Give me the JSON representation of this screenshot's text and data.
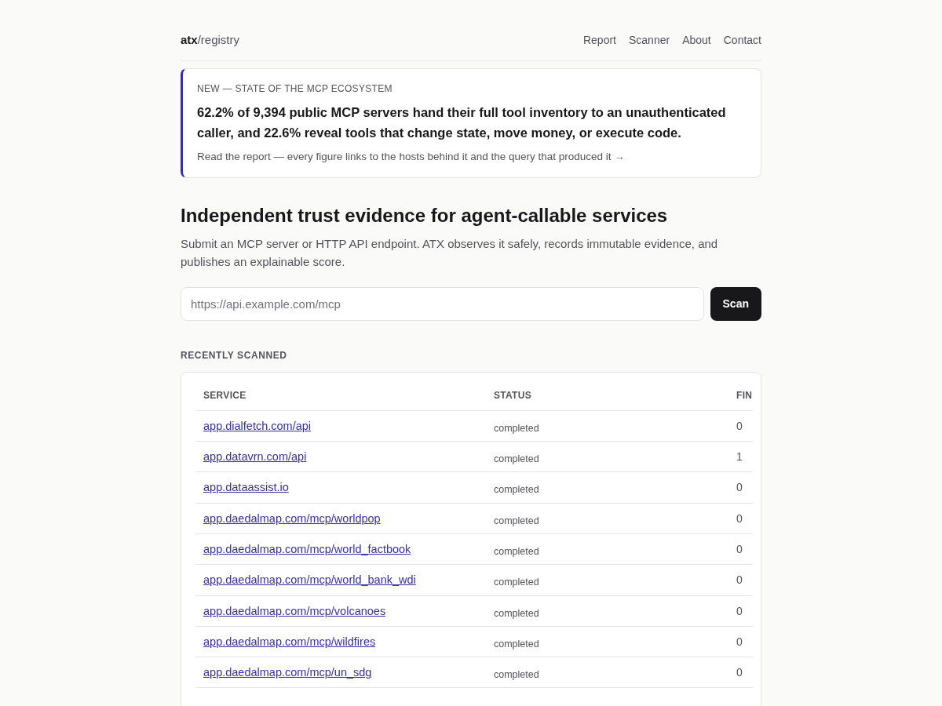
{
  "brand": {
    "name": "atx",
    "suffix": "/registry"
  },
  "nav": [
    "Report",
    "Scanner",
    "About",
    "Contact"
  ],
  "callout": {
    "eyebrow": "NEW — STATE OF THE MCP ECOSYSTEM",
    "headline": "62.2% of 9,394 public MCP servers hand their full tool inventory to an unauthenticated caller, and 22.6% reveal tools that change state, move money, or execute code.",
    "link": "Read the report — every figure links to the hosts behind it and the query that produced it →"
  },
  "hero": {
    "title": "Independent trust evidence for agent-callable services",
    "subtitle": "Submit an MCP server or HTTP API endpoint. ATX observes it safely, records immutable evidence, and publishes an explainable score."
  },
  "scan": {
    "placeholder": "https://api.example.com/mcp",
    "button": "Scan"
  },
  "recent": {
    "label": "RECENTLY SCANNED",
    "columns": [
      "SERVICE",
      "STATUS",
      "FIN"
    ],
    "rows": [
      {
        "service": "app.dialfetch.com/api",
        "status": "completed",
        "findings": "0"
      },
      {
        "service": "app.datavrn.com/api",
        "status": "completed",
        "findings": "1"
      },
      {
        "service": "app.dataassist.io",
        "status": "completed",
        "findings": "0"
      },
      {
        "service": "app.daedalmap.com/mcp/worldpop",
        "status": "completed",
        "findings": "0"
      },
      {
        "service": "app.daedalmap.com/mcp/world_factbook",
        "status": "completed",
        "findings": "0"
      },
      {
        "service": "app.daedalmap.com/mcp/world_bank_wdi",
        "status": "completed",
        "findings": "0"
      },
      {
        "service": "app.daedalmap.com/mcp/volcanoes",
        "status": "completed",
        "findings": "0"
      },
      {
        "service": "app.daedalmap.com/mcp/wildfires",
        "status": "completed",
        "findings": "0"
      },
      {
        "service": "app.daedalmap.com/mcp/un_sdg",
        "status": "completed",
        "findings": "0"
      }
    ]
  }
}
